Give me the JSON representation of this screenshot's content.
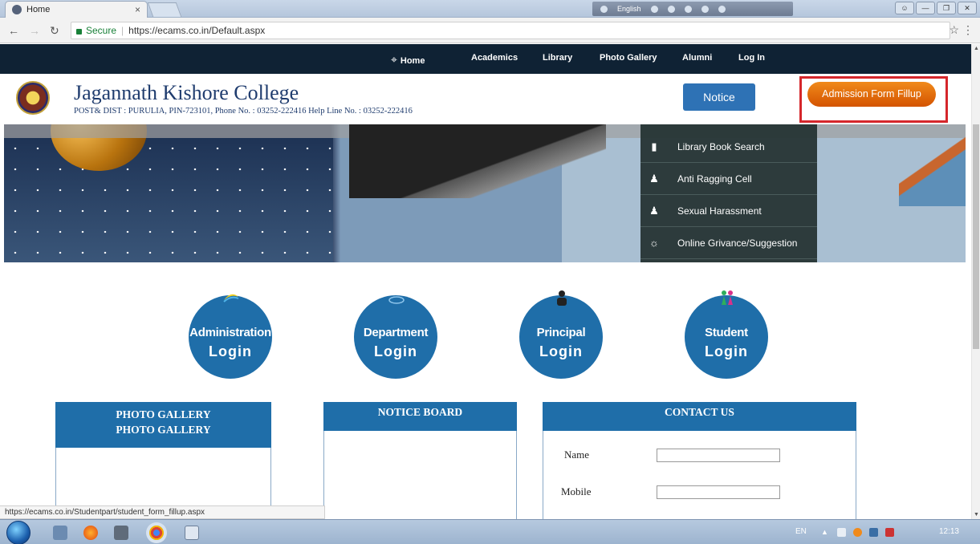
{
  "browser": {
    "tab_title": "Home",
    "tab_close": "×",
    "secure_label": "Secure",
    "url": "https://ecams.co.in/Default.aspx",
    "ime_label": "English",
    "status_url": "https://ecams.co.in/Studentpart/student_form_fillup.aspx"
  },
  "nav": {
    "home": "Home",
    "items": [
      "Academics",
      "Library",
      "Photo Gallery",
      "Alumni",
      "Log In"
    ]
  },
  "header": {
    "college_name": "Jagannath Kishore College",
    "address": "POST& DIST : PURULIA, PIN-723101, Phone No. : 03252-222416   Help Line No. : 03252-222416",
    "notice_button": "Notice",
    "admission_button": "Admission Form Fillup"
  },
  "quick_links": [
    {
      "label": "Library Book Search",
      "icon": "book-icon"
    },
    {
      "label": "Anti Ragging Cell",
      "icon": "group-icon"
    },
    {
      "label": "Sexual Harassment",
      "icon": "group-icon"
    },
    {
      "label": "Online Grivance/Suggestion",
      "icon": "bulb-icon"
    }
  ],
  "logins": [
    {
      "top": "Administration",
      "bottom": "Login",
      "emblem": "swoosh-icon"
    },
    {
      "top": "Department",
      "bottom": "Login",
      "emblem": "cloud-icon"
    },
    {
      "top": "Principal",
      "bottom": "Login",
      "emblem": "person-icon"
    },
    {
      "top": "Student",
      "bottom": "Login",
      "emblem": "people-icon"
    }
  ],
  "panels": {
    "photo_gallery": {
      "title_line1": "PHOTO GALLERY",
      "title_line2": "PHOTO GALLERY"
    },
    "notice_board": {
      "title": "NOTICE BOARD"
    },
    "contact_us": {
      "title": "CONTACT US",
      "name_label": "Name",
      "mobile_label": "Mobile"
    }
  },
  "taskbar": {
    "language": "EN",
    "clock": "12:13"
  },
  "colors": {
    "nav_bg": "#0f2234",
    "brand_blue": "#1f6ea9",
    "admission_orange": "#e26a0b",
    "highlight_red": "#d5262b"
  }
}
